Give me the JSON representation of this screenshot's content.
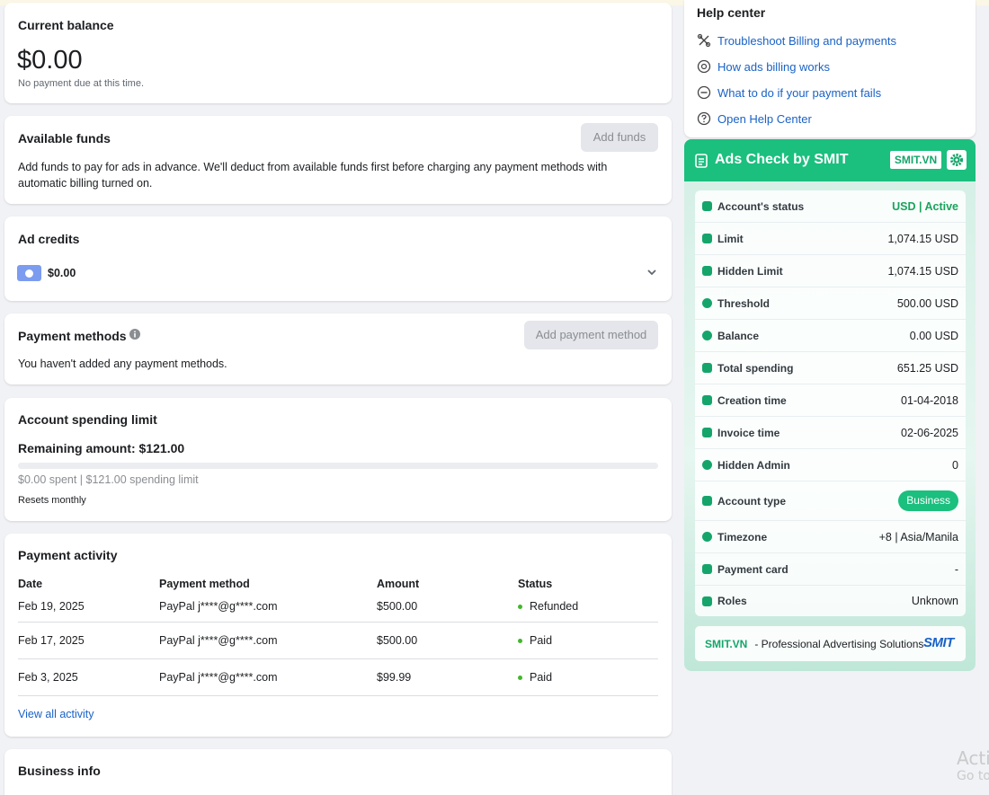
{
  "balance": {
    "title": "Current balance",
    "amount": "$0.00",
    "note": "No payment due at this time."
  },
  "funds": {
    "title": "Available funds",
    "button": "Add funds",
    "description": "Add funds to pay for ads in advance. We'll deduct from available funds first before charging any payment methods with automatic billing turned on."
  },
  "credits": {
    "title": "Ad credits",
    "amount": "$0.00"
  },
  "payment_methods": {
    "title": "Payment methods",
    "button": "Add payment method",
    "empty": "You haven't added any payment methods."
  },
  "spending_limit": {
    "title": "Account spending limit",
    "remaining": "Remaining amount: $121.00",
    "progress_fraction": 0,
    "spent_text": "$0.00 spent | $121.00 spending limit",
    "resets": "Resets monthly"
  },
  "activity": {
    "title": "Payment activity",
    "headers": [
      "Date",
      "Payment method",
      "Amount",
      "Status"
    ],
    "rows": [
      {
        "date": "Feb 19, 2025",
        "method": "PayPal j****@g****.com",
        "amount": "$500.00",
        "status": "Refunded"
      },
      {
        "date": "Feb 17, 2025",
        "method": "PayPal j****@g****.com",
        "amount": "$500.00",
        "status": "Paid"
      },
      {
        "date": "Feb 3, 2025",
        "method": "PayPal j****@g****.com",
        "amount": "$99.99",
        "status": "Paid"
      }
    ],
    "view_all": "View all activity"
  },
  "business": {
    "title": "Business info"
  },
  "help": {
    "title": "Help center",
    "items": [
      {
        "label": "Troubleshoot Billing and payments",
        "icon": "tools-icon"
      },
      {
        "label": "How ads billing works",
        "icon": "billing-icon"
      },
      {
        "label": "What to do if your payment fails",
        "icon": "minus-circle-icon"
      },
      {
        "label": "Open Help Center",
        "icon": "question-icon"
      }
    ]
  },
  "smit": {
    "title": "Ads Check by SMIT",
    "badge": "SMIT.VN",
    "rows": [
      {
        "label": "Account's status",
        "value": "USD | Active"
      },
      {
        "label": "Limit",
        "value": "1,074.15 USD"
      },
      {
        "label": "Hidden Limit",
        "value": "1,074.15 USD"
      },
      {
        "label": "Threshold",
        "value": "500.00 USD"
      },
      {
        "label": "Balance",
        "value": "0.00 USD"
      },
      {
        "label": "Total spending",
        "value": "651.25 USD"
      },
      {
        "label": "Creation time",
        "value": "01-04-2018"
      },
      {
        "label": "Invoice time",
        "value": "02-06-2025"
      },
      {
        "label": "Hidden Admin",
        "value": "0"
      },
      {
        "label": "Account type",
        "value": "Business"
      },
      {
        "label": "Timezone",
        "value": "+8 | Asia/Manila"
      },
      {
        "label": "Payment card",
        "value": "-"
      },
      {
        "label": "Roles",
        "value": "Unknown"
      }
    ],
    "footer_brand": "SMIT.VN",
    "footer_text": " - Professional Advertising Solutions",
    "footer_logo": "SMIT"
  },
  "watermark": {
    "line1": "Activ",
    "line2": "Go to"
  },
  "colors": {
    "accent": "#1bbf7e",
    "link": "#1a62c6",
    "status_dot": "#42b72a"
  }
}
